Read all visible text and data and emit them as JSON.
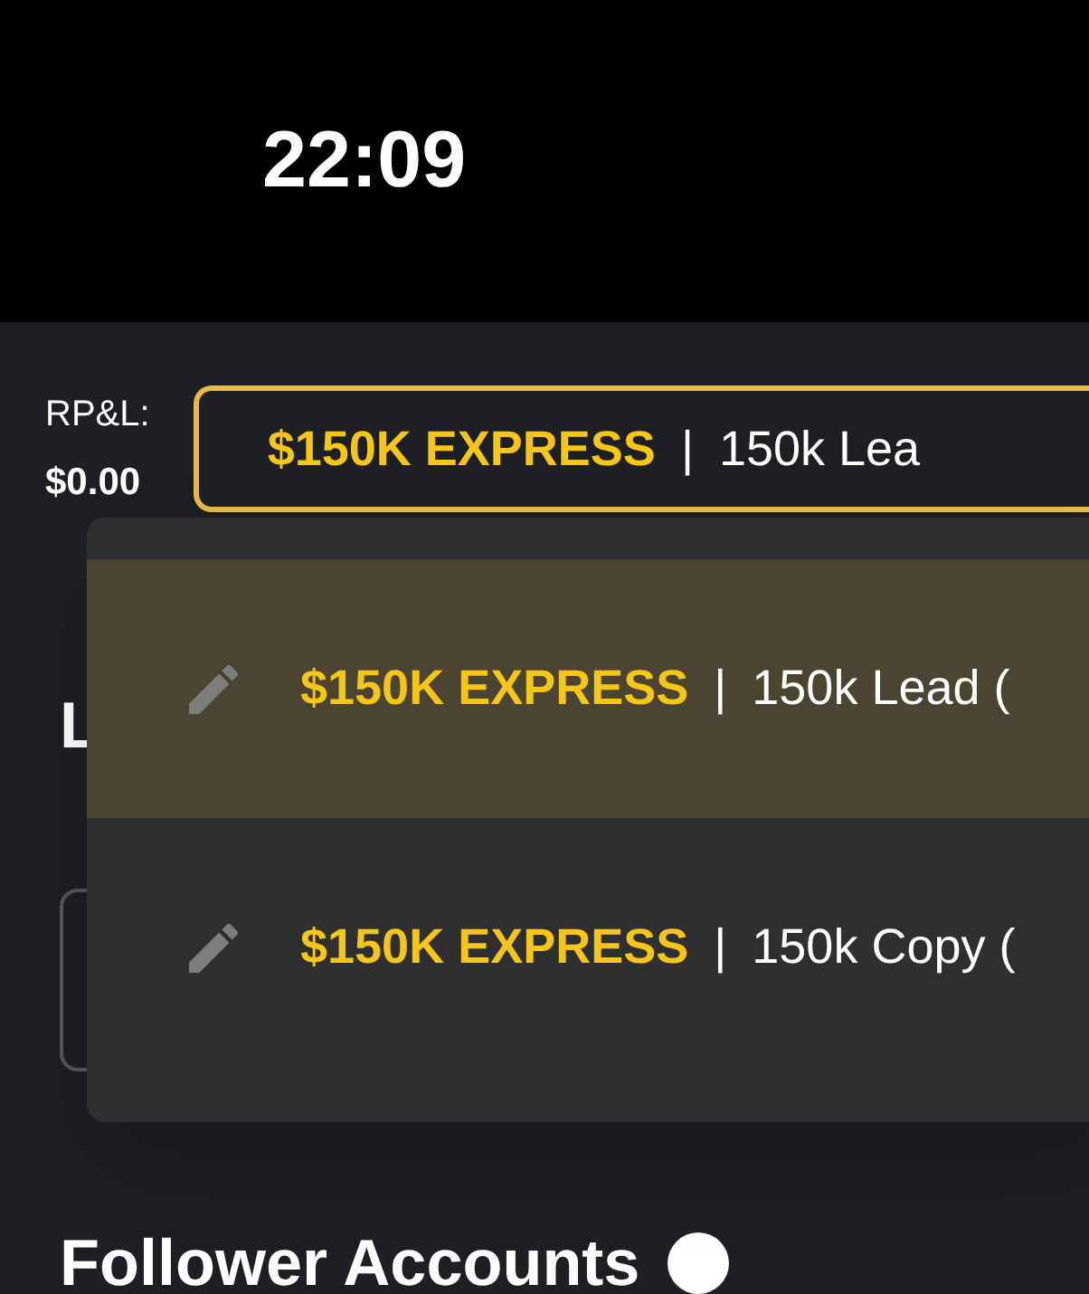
{
  "status_bar": {
    "time": "22:09"
  },
  "rpl": {
    "label": "RP&L:",
    "value": "$0.00"
  },
  "account_select": {
    "plan": "$150K EXPRESS",
    "separator": "|",
    "name": "150k Lea"
  },
  "menu": {
    "items": [
      {
        "plan": "$150K EXPRESS",
        "separator": "|",
        "name": "150k Lead (",
        "selected": true
      },
      {
        "plan": "$150K EXPRESS",
        "separator": "|",
        "name": "150k Copy (",
        "selected": false
      }
    ]
  },
  "section_heading": "L",
  "follower_heading": "Follower Accounts"
}
